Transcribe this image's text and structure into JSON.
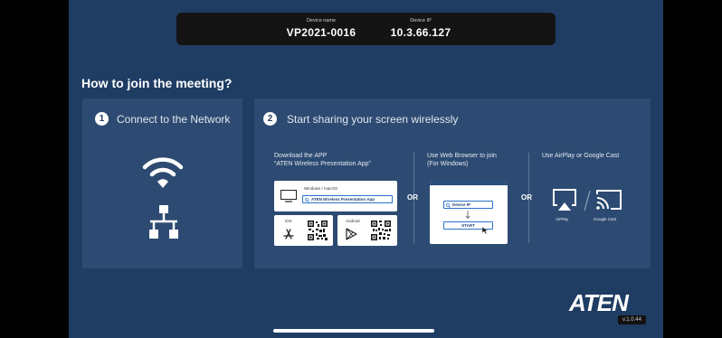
{
  "device": {
    "name_label": "Device name",
    "name_value": "VP2021-0016",
    "ip_label": "Device IP",
    "ip_value": "10.3.66.127"
  },
  "heading": "How to join the meeting?",
  "step1": {
    "number": "1",
    "title": "Connect to the Network"
  },
  "step2": {
    "number": "2",
    "title": "Start sharing your screen wirelessly",
    "col_app": {
      "line1": "Download the APP",
      "line2": "“ATEN Wireless Presentation App”",
      "platform_desktop": "Windows / macOS",
      "app_search": "ATEN Wireless Presentation App",
      "ios_label": "iOS",
      "android_label": "Android"
    },
    "or_1": "OR",
    "col_browser": {
      "line1": "Use Web Browser to join",
      "line2": "(For Windows)",
      "field_label": "Device IP",
      "start_button": "START"
    },
    "or_2": "OR",
    "col_cast": {
      "line1": "Use AirPlay or Google Cast",
      "airplay_label": "AirPlay",
      "cast_label": "Google Cast"
    }
  },
  "brand": {
    "logo": "ATEN",
    "version": "v.1.0.44"
  },
  "colors": {
    "background": "#1f3c63",
    "card": "#2d4b72",
    "accent": "#2a72c8"
  },
  "icons": [
    "wifi-icon",
    "network-icon",
    "monitor-icon",
    "app-store-icon",
    "play-store-icon",
    "airplay-icon",
    "google-cast-icon",
    "cursor-icon",
    "search-icon"
  ]
}
